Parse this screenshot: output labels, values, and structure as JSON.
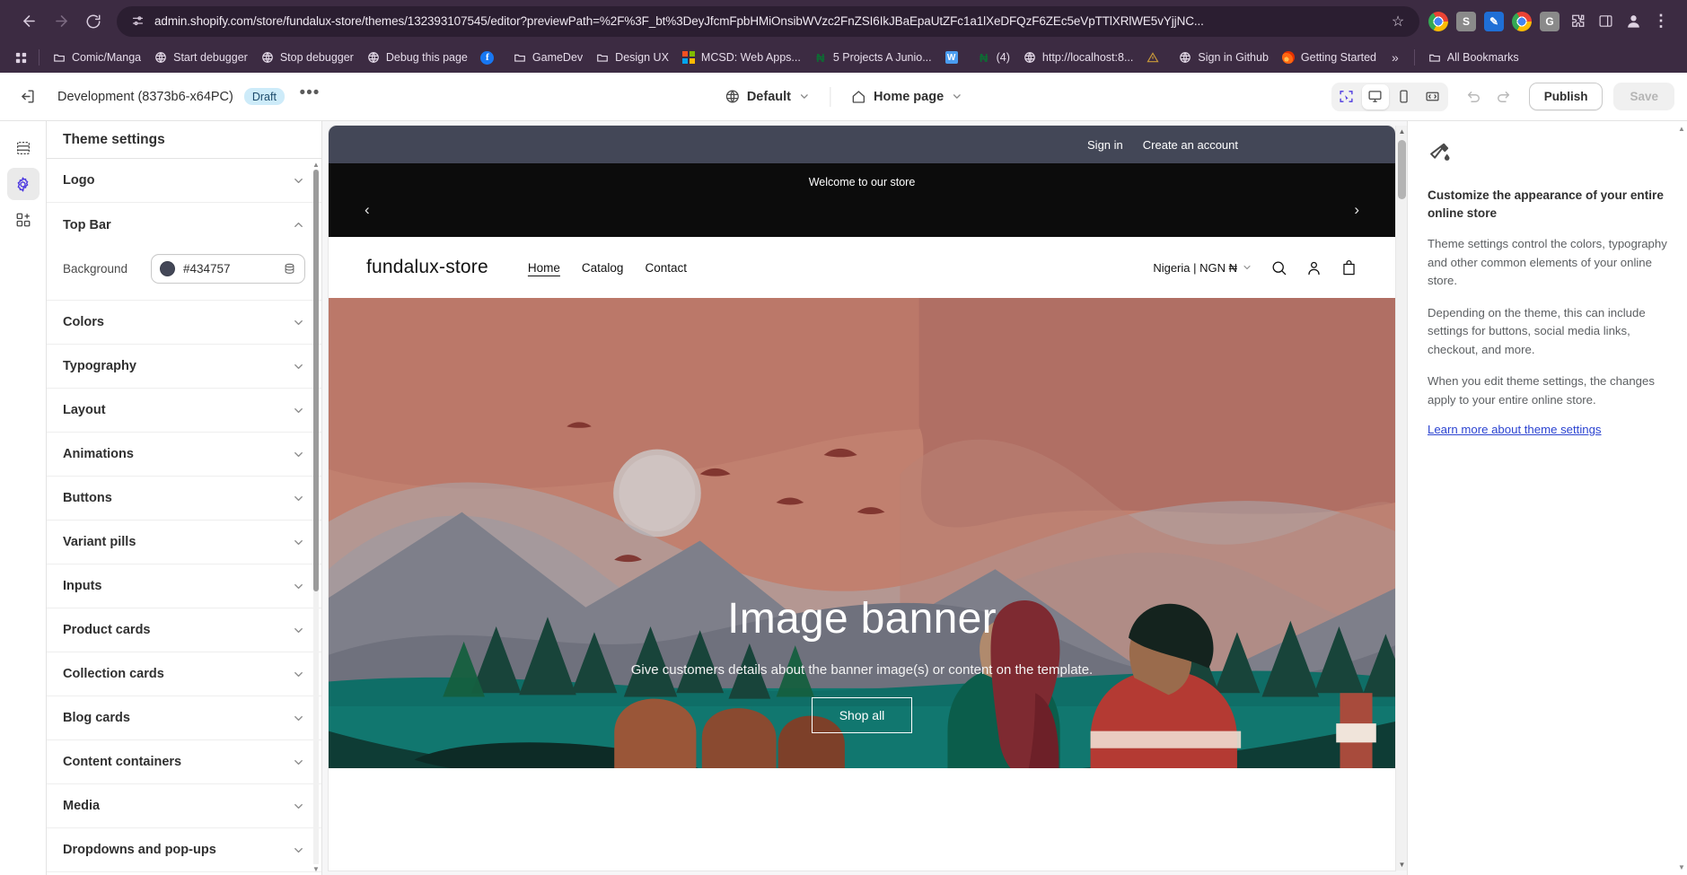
{
  "browser": {
    "url": "admin.shopify.com/store/fundalux-store/themes/132393107545/editor?previewPath=%2F%3F_bt%3DeyJfcmFpbHMiOnsibWVzc2FnZSI6IkJBaEpaUtZFc1a1lXeDFQzF6ZEc5eVpTTlXRlWE5vYjjNC...",
    "nav": {
      "back": "back-arrow",
      "forward": "forward-arrow",
      "reload": "reload-icon"
    },
    "bookmarks": [
      {
        "label": "Comic/Manga",
        "icon": "folder-icon"
      },
      {
        "label": "Start debugger",
        "icon": "globe-icon"
      },
      {
        "label": "Stop debugger",
        "icon": "globe-icon"
      },
      {
        "label": "Debug this page",
        "icon": "globe-icon"
      },
      {
        "label": "",
        "icon": "facebook-icon"
      },
      {
        "label": "GameDev",
        "icon": "folder-icon"
      },
      {
        "label": "Design UX",
        "icon": "folder-icon"
      },
      {
        "label": "MCSD: Web Apps...",
        "icon": "microsoft-icon"
      },
      {
        "label": "5 Projects A Junio...",
        "icon": "naira-icon"
      },
      {
        "label": "",
        "icon": "word-icon"
      },
      {
        "label": "(4)",
        "icon": "naira-icon"
      },
      {
        "label": "http://localhost:8...",
        "icon": "globe-icon"
      },
      {
        "label": "",
        "icon": "warning-icon"
      },
      {
        "label": "Sign in Github",
        "icon": "globe-icon"
      },
      {
        "label": "Getting Started",
        "icon": "firefox-icon"
      }
    ],
    "overflow": "»",
    "all_bookmarks": "All Bookmarks"
  },
  "editor": {
    "theme_name": "Development (8373b6-x64PC)",
    "status_badge": "Draft",
    "more_actions": "•••",
    "locale_label": "Default",
    "page_label": "Home page",
    "view_modes": [
      {
        "name": "inspector",
        "icon": "select-region-icon",
        "selected": true
      },
      {
        "name": "desktop",
        "icon": "desktop-icon",
        "selected": true
      },
      {
        "name": "mobile",
        "icon": "mobile-icon",
        "selected": false
      },
      {
        "name": "fullwidth",
        "icon": "full-width-icon",
        "selected": false
      }
    ],
    "undo": "undo-icon",
    "redo": "redo-icon",
    "publish_label": "Publish",
    "save_label": "Save"
  },
  "rail": [
    {
      "name": "sections",
      "icon": "sections-icon",
      "active": false
    },
    {
      "name": "theme-settings",
      "icon": "gear-icon",
      "active": true
    },
    {
      "name": "apps",
      "icon": "apps-add-icon",
      "active": false
    }
  ],
  "settings_panel": {
    "title": "Theme settings",
    "groups": [
      {
        "label": "Logo",
        "open": false
      },
      {
        "label": "Top Bar",
        "open": true
      },
      {
        "label": "Colors",
        "open": false
      },
      {
        "label": "Typography",
        "open": false
      },
      {
        "label": "Layout",
        "open": false
      },
      {
        "label": "Animations",
        "open": false
      },
      {
        "label": "Buttons",
        "open": false
      },
      {
        "label": "Variant pills",
        "open": false
      },
      {
        "label": "Inputs",
        "open": false
      },
      {
        "label": "Product cards",
        "open": false
      },
      {
        "label": "Collection cards",
        "open": false
      },
      {
        "label": "Blog cards",
        "open": false
      },
      {
        "label": "Content containers",
        "open": false
      },
      {
        "label": "Media",
        "open": false
      },
      {
        "label": "Dropdowns and pop-ups",
        "open": false
      }
    ],
    "top_bar": {
      "background_label": "Background",
      "background_value": "#434757",
      "swatch_color": "#434757",
      "source_icon": "database-icon"
    }
  },
  "info_panel": {
    "icon": "paint-roller-icon",
    "heading": "Customize the appearance of your entire online store",
    "paragraphs": [
      "Theme settings control the colors, typography and other common elements of your online store.",
      "Depending on the theme, this can include settings for buttons, social media links, checkout, and more.",
      "When you edit theme settings, the changes apply to your entire online store."
    ],
    "link": "Learn more about theme settings"
  },
  "store_preview": {
    "topbar": {
      "background": "#434757",
      "sign_in": "Sign in",
      "create_account": "Create an account"
    },
    "announcement": {
      "background": "#0c0c0c",
      "message": "Welcome to our store",
      "prev": "‹",
      "next": "›"
    },
    "header": {
      "logo": "fundalux-store",
      "nav": [
        {
          "label": "Home",
          "current": true
        },
        {
          "label": "Catalog",
          "current": false
        },
        {
          "label": "Contact",
          "current": false
        }
      ],
      "currency": "Nigeria | NGN ₦",
      "icons": [
        "search-icon",
        "account-icon",
        "cart-icon"
      ]
    },
    "hero": {
      "heading": "Image banner",
      "subheading": "Give customers details about the banner image(s) or content on the template.",
      "button": "Shop all"
    }
  }
}
